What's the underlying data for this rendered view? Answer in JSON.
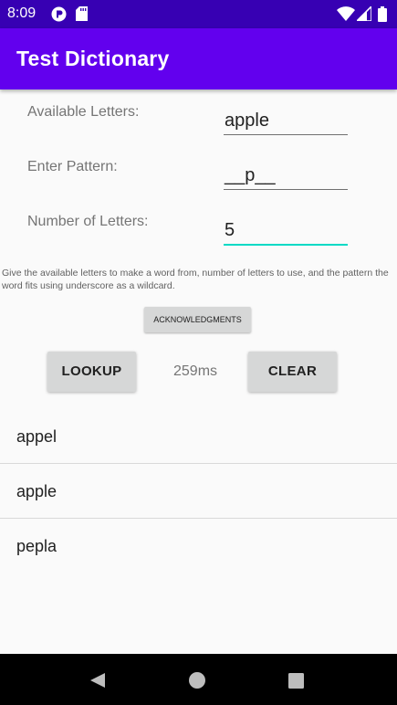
{
  "status_bar": {
    "time": "8:09",
    "icons_left": [
      "media-icon",
      "sd-card-icon"
    ],
    "icons_right": [
      "wifi-icon",
      "signal-icon",
      "battery-icon"
    ]
  },
  "app_bar": {
    "title": "Test Dictionary",
    "color": "#6200ee"
  },
  "form": {
    "available_letters_label": "Available Letters:",
    "available_letters_value": "apple",
    "pattern_label": "Enter Pattern:",
    "pattern_value": "__p__",
    "num_letters_label": "Number of Letters:",
    "num_letters_value": "5"
  },
  "help_text": "Give the available letters to make a word from, number of letters to use, and the pattern the word fits using underscore as a wildcard.",
  "buttons": {
    "acknowledgments": "ACKNOWLEDGMENTS",
    "lookup": "LOOKUP",
    "clear": "CLEAR"
  },
  "timing": "259ms",
  "results": [
    "appel",
    "apple",
    "pepla"
  ],
  "nav_bar": {
    "icons": [
      "back-icon",
      "home-icon",
      "recents-icon"
    ]
  },
  "colors": {
    "accent": "#03dac5",
    "primary": "#6200ee",
    "primary_dark": "#3700b3"
  }
}
